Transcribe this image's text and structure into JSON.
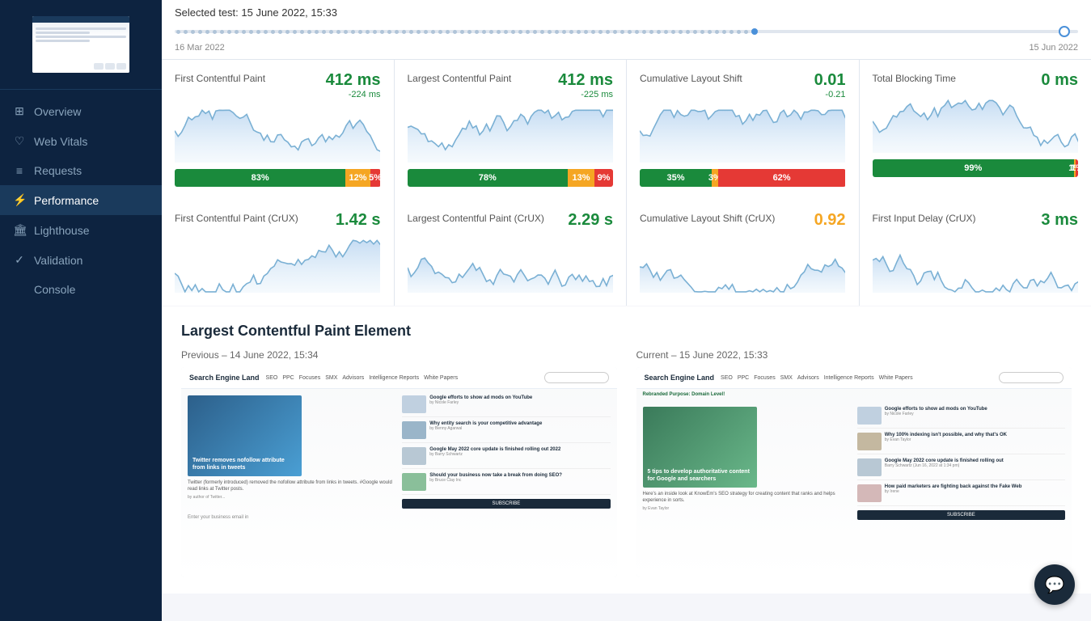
{
  "sidebar": {
    "nav_items": [
      {
        "id": "overview",
        "label": "Overview",
        "icon": "⊞",
        "active": false
      },
      {
        "id": "web-vitals",
        "label": "Web Vitals",
        "icon": "♡",
        "active": false
      },
      {
        "id": "requests",
        "label": "Requests",
        "icon": "≡",
        "active": false
      },
      {
        "id": "performance",
        "label": "Performance",
        "icon": "⚡",
        "active": true
      },
      {
        "id": "lighthouse",
        "label": "Lighthouse",
        "icon": "🏛",
        "active": false
      },
      {
        "id": "validation",
        "label": "Validation",
        "icon": "✓",
        "active": false
      },
      {
        "id": "console",
        "label": "Console",
        "icon": "</>",
        "active": false
      }
    ]
  },
  "timeline": {
    "selected_label": "Selected test: 15 June 2022, 15:33",
    "start_date": "16 Mar 2022",
    "end_date": "15 Jun 2022"
  },
  "metrics_row1": [
    {
      "id": "fcp",
      "title": "First Contentful Paint",
      "value": "412 ms",
      "value_color": "green",
      "delta": "-224 ms",
      "delta_color": "green",
      "distribution": [
        {
          "label": "83%",
          "pct": 83,
          "type": "good"
        },
        {
          "label": "12%",
          "pct": 12,
          "type": "medium"
        },
        {
          "label": "5%",
          "pct": 5,
          "type": "poor"
        }
      ]
    },
    {
      "id": "lcp",
      "title": "Largest Contentful Paint",
      "value": "412 ms",
      "value_color": "green",
      "delta": "-225 ms",
      "delta_color": "green",
      "distribution": [
        {
          "label": "78%",
          "pct": 78,
          "type": "good"
        },
        {
          "label": "13%",
          "pct": 13,
          "type": "medium"
        },
        {
          "label": "9%",
          "pct": 9,
          "type": "poor"
        }
      ]
    },
    {
      "id": "cls",
      "title": "Cumulative Layout Shift",
      "value": "0.01",
      "value_color": "green",
      "delta": "-0.21",
      "delta_color": "green",
      "distribution": [
        {
          "label": "35%",
          "pct": 35,
          "type": "good"
        },
        {
          "label": "3%",
          "pct": 3,
          "type": "medium"
        },
        {
          "label": "62%",
          "pct": 62,
          "type": "poor"
        }
      ]
    },
    {
      "id": "tbt",
      "title": "Total Blocking Time",
      "value": "0 ms",
      "value_color": "green",
      "delta": "",
      "delta_color": "green",
      "distribution": [
        {
          "label": "99%",
          "pct": 99,
          "type": "good"
        },
        {
          "label": "1%",
          "pct": 1,
          "type": "medium"
        },
        {
          "label": "1%",
          "pct": 1,
          "type": "poor"
        }
      ]
    }
  ],
  "metrics_row2": [
    {
      "id": "fcp-crux",
      "title": "First Contentful Paint (CrUX)",
      "value": "1.42 s",
      "value_color": "green",
      "delta": "",
      "delta_color": "green",
      "distribution": []
    },
    {
      "id": "lcp-crux",
      "title": "Largest Contentful Paint (CrUX)",
      "value": "2.29 s",
      "value_color": "green",
      "delta": "",
      "delta_color": "green",
      "distribution": []
    },
    {
      "id": "cls-crux",
      "title": "Cumulative Layout Shift (CrUX)",
      "value": "0.92",
      "value_color": "yellow",
      "delta": "",
      "delta_color": "green",
      "distribution": []
    },
    {
      "id": "fid-crux",
      "title": "First Input Delay (CrUX)",
      "value": "3 ms",
      "value_color": "green",
      "delta": "",
      "delta_color": "green",
      "distribution": []
    }
  ],
  "lcp_section": {
    "title": "Largest Contentful Paint Element",
    "previous_label": "Previous – 14 June 2022, 15:34",
    "current_label": "Current – 15 June 2022, 15:33"
  },
  "chat_button": {
    "icon": "💬"
  }
}
